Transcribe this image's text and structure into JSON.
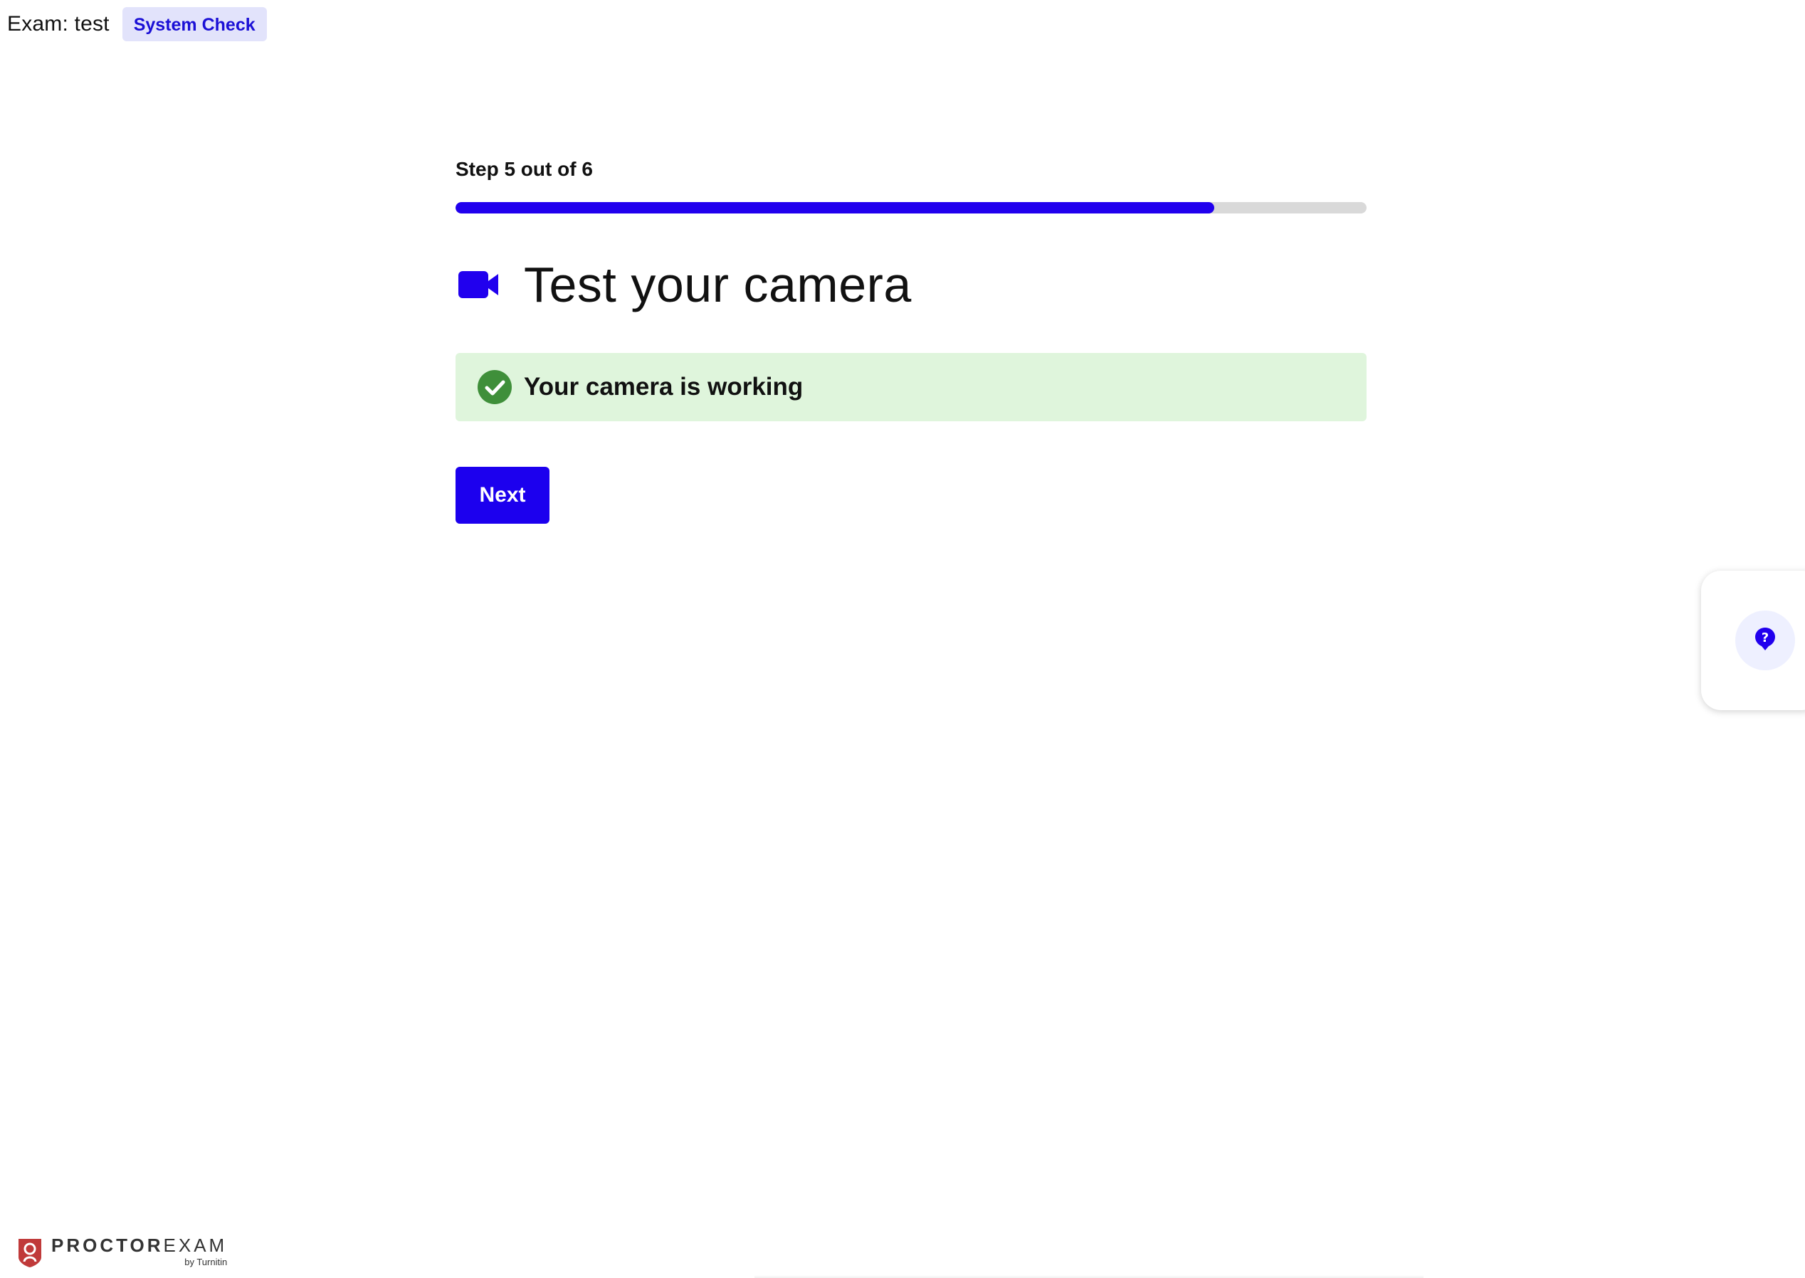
{
  "header": {
    "exam_label": "Exam: test",
    "badge": "System Check"
  },
  "progress": {
    "label": "Step 5 out of 6",
    "current_step": 5,
    "total_steps": 6,
    "fill_fraction": 0.833,
    "color": "#2100ee"
  },
  "main": {
    "title": "Test your camera",
    "title_icon": "video-camera-icon",
    "status": {
      "text": "Your camera is working",
      "icon": "check-circle-icon",
      "color": "#3f8f3a"
    },
    "next_button": "Next"
  },
  "help": {
    "icon": "help-question-icon"
  },
  "footer": {
    "logo_main_strong": "PROCTOR",
    "logo_main_light": "EXAM",
    "logo_sub": "by Turnitin"
  },
  "colors": {
    "accent": "#1c00ee",
    "success_bg": "#dff5dc",
    "badge_bg": "#e2e3fb"
  }
}
